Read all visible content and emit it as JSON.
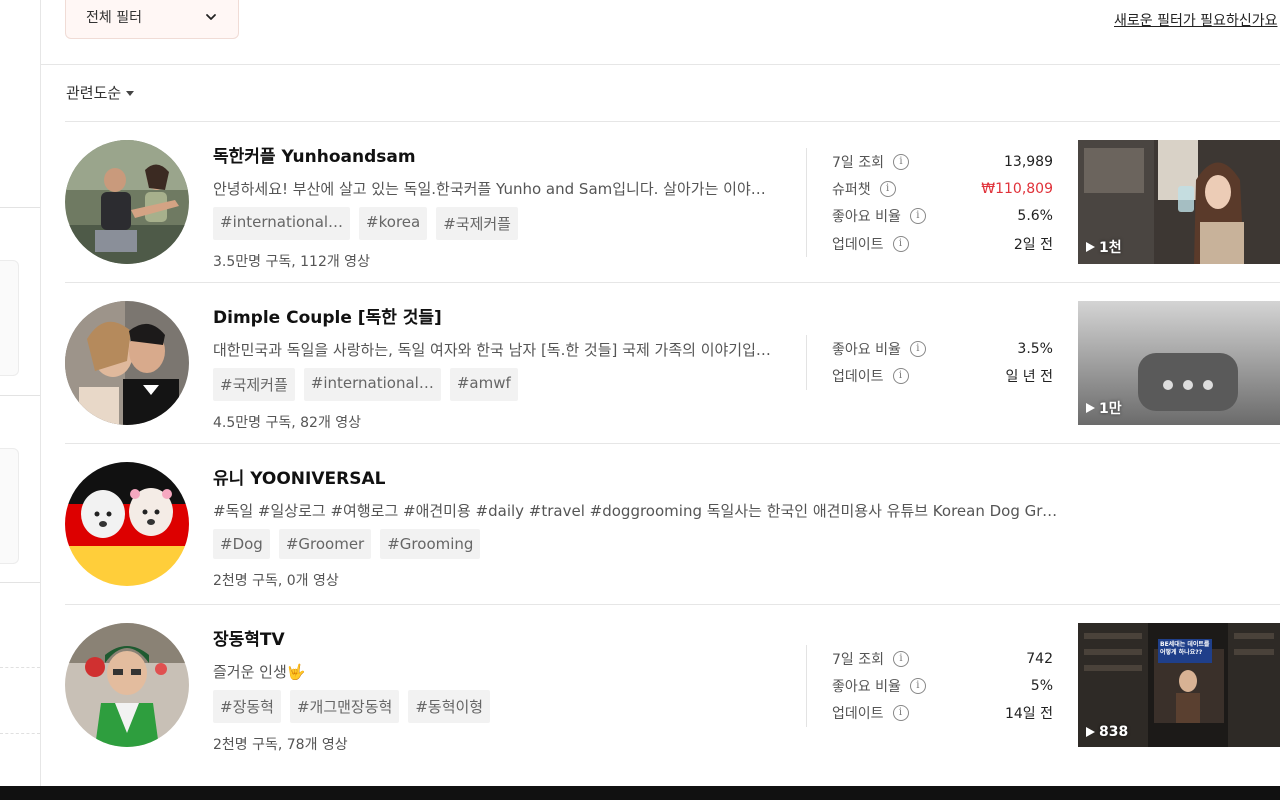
{
  "header": {
    "filter_label": "전체 필터",
    "new_filter_link": "새로운 필터가 필요하신가요"
  },
  "sort_label": "관련도순",
  "channels": [
    {
      "name": "독한커플 Yunhoandsam",
      "description": "안녕하세요! 부산에 살고 있는 독일.한국커플 Yunho and Sam입니다. 살아가는 이야기를 담고 있습니다",
      "tags": [
        "#international…",
        "#korea",
        "#국제커플"
      ],
      "meta": "3.5만명 구독,  112개 영상",
      "stats": [
        {
          "label": "7일 조회",
          "value": "13,989"
        },
        {
          "label": "슈퍼챗",
          "value": "₩110,809",
          "highlight": true
        },
        {
          "label": "좋아요 비율",
          "value": "5.6%"
        },
        {
          "label": "업데이트",
          "value": "2일 전"
        }
      ],
      "video_views": "1천"
    },
    {
      "name": "Dimple Couple [독한 것들]",
      "description": "대한민국과 독일을 사랑하는, 독일 여자와 한국 남자 [독.한 것들] 국제 가족의 이야기입니다",
      "tags": [
        "#국제커플",
        "#international…",
        "#amwf"
      ],
      "meta": "4.5만명 구독,  82개 영상",
      "stats": [
        {
          "label": "좋아요 비율",
          "value": "3.5%"
        },
        {
          "label": "업데이트",
          "value": "일 년 전"
        }
      ],
      "video_views": "1만"
    },
    {
      "name": "유니 YOONIVERSAL",
      "description": "#독일 #일상로그 #여행로그 #애견미용 #daily #travel #doggrooming 독일사는 한국인 애견미용사 유튜브 Korean Dog Groomer",
      "tags": [
        "#Dog",
        "#Groomer",
        "#Grooming"
      ],
      "meta": "2천명 구독,  0개 영상",
      "stats": [],
      "video_views": ""
    },
    {
      "name": "장동혁TV",
      "description": "즐거운 인생🤟",
      "tags": [
        "#장동혁",
        "#개그맨장동혁",
        "#동혁이형"
      ],
      "meta": "2천명 구독,  78개 영상",
      "stats": [
        {
          "label": "7일 조회",
          "value": "742"
        },
        {
          "label": "좋아요 비율",
          "value": "5%"
        },
        {
          "label": "업데이트",
          "value": "14일 전"
        }
      ],
      "video_views": "838",
      "thumb_caption": "BE세대는 데이트를 어떻게 하나요??"
    }
  ],
  "colors": {
    "accent_red": "#e0323a",
    "filter_bg": "#fff7f5"
  }
}
